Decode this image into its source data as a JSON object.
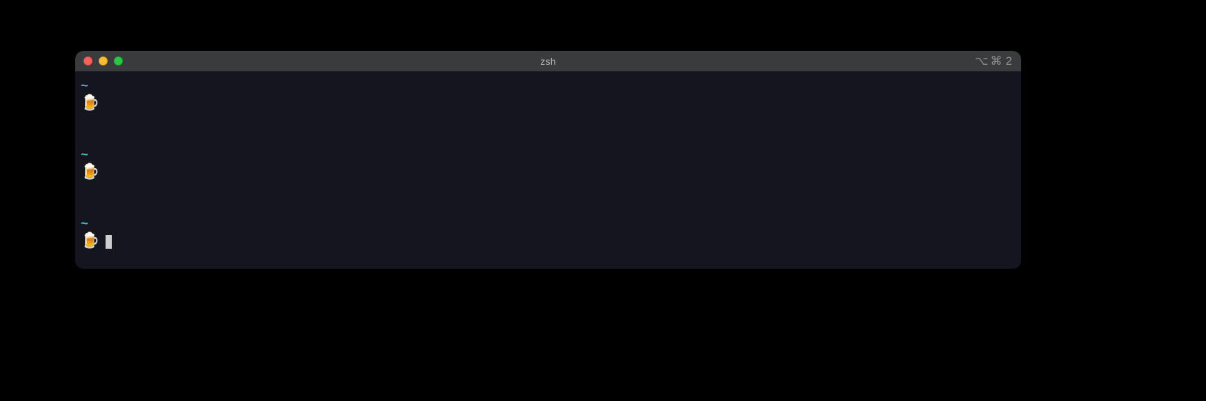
{
  "window": {
    "title": "zsh",
    "pane_indicator": {
      "option_glyph": "⌥",
      "command_glyph": "⌘",
      "number": "2"
    }
  },
  "terminal": {
    "path_symbol": "~",
    "prompt_emoji": "🍺",
    "prompts": [
      {
        "command": ""
      },
      {
        "command": ""
      },
      {
        "command": ""
      }
    ],
    "active_prompt_index": 2
  }
}
